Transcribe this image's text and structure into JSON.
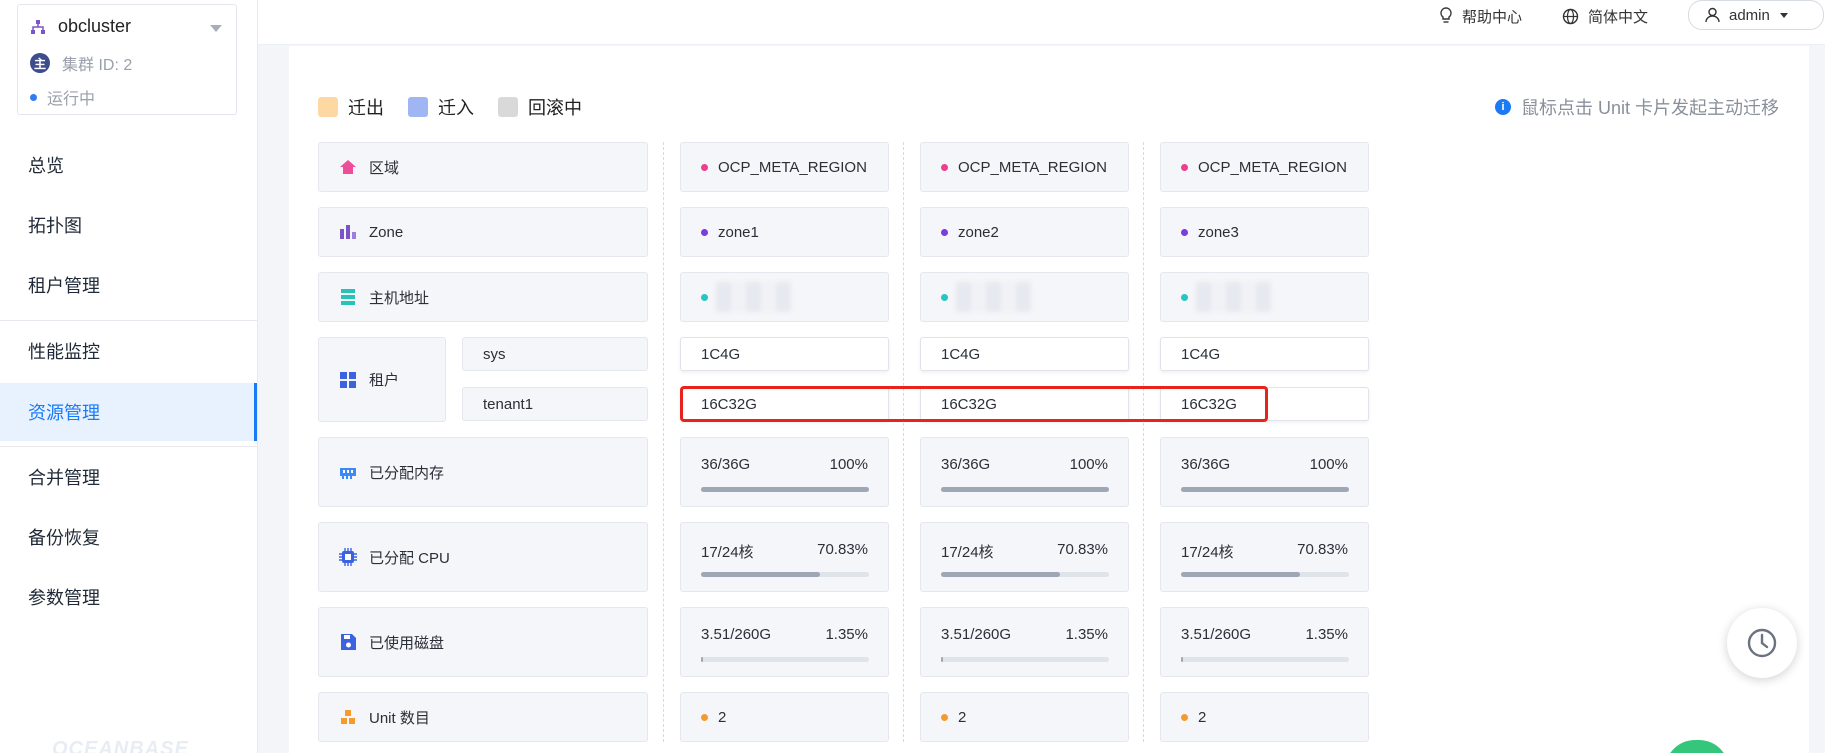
{
  "cluster": {
    "name": "obcluster",
    "id_label": "集群 ID: 2",
    "id_badge": "主",
    "status": "运行中"
  },
  "nav": [
    "总览",
    "拓扑图",
    "租户管理",
    "性能监控",
    "资源管理",
    "合并管理",
    "备份恢复",
    "参数管理"
  ],
  "nav_active": "资源管理",
  "watermark": "OCEANBASE",
  "topbar": {
    "help": "帮助中心",
    "lang": "简体中文",
    "user": "admin"
  },
  "legend": {
    "out": "迁出",
    "in": "迁入",
    "rollback": "回滚中"
  },
  "hint": "鼠标点击 Unit 卡片发起主动迁移",
  "colors": {
    "out": "#fdd8a3",
    "in": "#9fb6f3",
    "rollback": "#d9d9d9",
    "accent": "#1b7af5",
    "highlight": "#e8231e"
  },
  "rows": {
    "region": "区域",
    "zone": "Zone",
    "host": "主机地址",
    "tenant": "租户",
    "tenant_sys": "sys",
    "tenant_1": "tenant1",
    "memory": "已分配内存",
    "cpu": "已分配 CPU",
    "disk": "已使用磁盘",
    "units": "Unit 数目"
  },
  "zones": [
    {
      "region": "OCP_META_REGION",
      "zone": "zone1",
      "sys": "1C4G",
      "tenant1": "16C32G",
      "mem": "36/36G",
      "mem_pct": "100%",
      "mem_frac": 1.0,
      "cpu": "17/24核",
      "cpu_pct": "70.83%",
      "cpu_frac": 0.7083,
      "disk": "3.51/260G",
      "disk_pct": "1.35%",
      "disk_frac": 0.0135,
      "units": "2"
    },
    {
      "region": "OCP_META_REGION",
      "zone": "zone2",
      "sys": "1C4G",
      "tenant1": "16C32G",
      "mem": "36/36G",
      "mem_pct": "100%",
      "mem_frac": 1.0,
      "cpu": "17/24核",
      "cpu_pct": "70.83%",
      "cpu_frac": 0.7083,
      "disk": "3.51/260G",
      "disk_pct": "1.35%",
      "disk_frac": 0.0135,
      "units": "2"
    },
    {
      "region": "OCP_META_REGION",
      "zone": "zone3",
      "sys": "1C4G",
      "tenant1": "16C32G",
      "mem": "36/36G",
      "mem_pct": "100%",
      "mem_frac": 1.0,
      "cpu": "17/24核",
      "cpu_pct": "70.83%",
      "cpu_frac": 0.7083,
      "disk": "3.51/260G",
      "disk_pct": "1.35%",
      "disk_frac": 0.0135,
      "units": "2"
    }
  ],
  "icons": {
    "history": "clock-icon"
  }
}
